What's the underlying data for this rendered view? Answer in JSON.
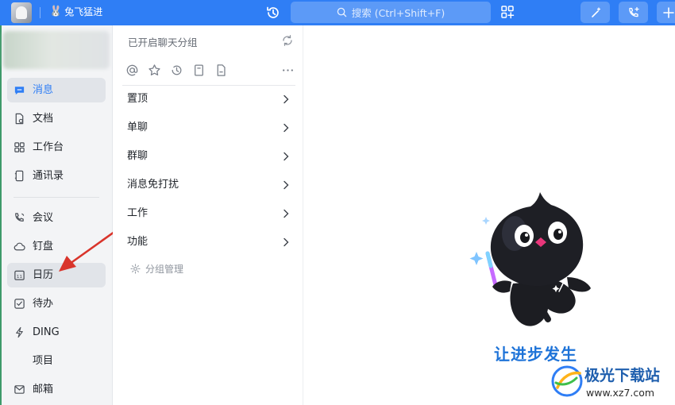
{
  "topbar": {
    "org_name": "兔飞猛进",
    "org_icon": "bunny-emoji",
    "search_placeholder": "搜索 (Ctrl+Shift+F)",
    "accent_color": "#2f7ef5"
  },
  "nav": {
    "items": [
      {
        "label": "消息",
        "icon": "message-icon"
      },
      {
        "label": "文档",
        "icon": "document-icon"
      },
      {
        "label": "工作台",
        "icon": "grid-icon"
      },
      {
        "label": "通讯录",
        "icon": "contacts-icon"
      },
      {
        "label": "会议",
        "icon": "phone-icon"
      },
      {
        "label": "钉盘",
        "icon": "cloud-icon"
      },
      {
        "label": "日历",
        "icon": "calendar-icon"
      },
      {
        "label": "待办",
        "icon": "checkbox-icon"
      },
      {
        "label": "DING",
        "icon": "lightning-icon"
      },
      {
        "label": "项目",
        "icon": "project-icon"
      },
      {
        "label": "邮箱",
        "icon": "mail-icon"
      }
    ],
    "active_index": 0,
    "hover_index": 6
  },
  "middle": {
    "title": "已开启聊天分组",
    "groups": [
      "置顶",
      "单聊",
      "群聊",
      "消息免打扰",
      "工作",
      "功能"
    ],
    "manage_label": "分组管理"
  },
  "right": {
    "slogan": "让进步发生"
  },
  "watermark": {
    "title": "极光下载站",
    "url": "www.xz7.com"
  }
}
